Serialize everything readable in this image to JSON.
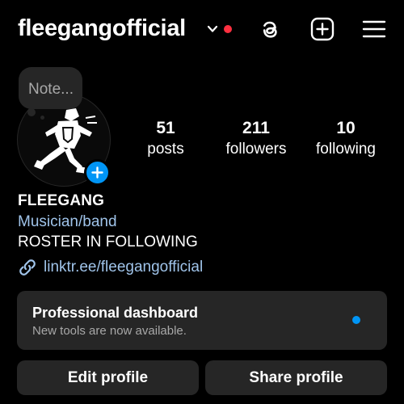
{
  "header": {
    "username": "fleegangofficial",
    "notification_dot_color": "#ff3040",
    "icons": [
      "chevron-down-icon",
      "threads-icon",
      "create-post-icon",
      "hamburger-menu-icon"
    ]
  },
  "note": {
    "placeholder": "Note..."
  },
  "profile": {
    "avatar_icon": "running-figure-logo",
    "stats": {
      "posts": {
        "count": "51",
        "label": "posts"
      },
      "followers": {
        "count": "211",
        "label": "followers"
      },
      "following": {
        "count": "10",
        "label": "following"
      }
    },
    "display_name": "FLEEGANG",
    "category": "Musician/band",
    "bio": "ROSTER IN FOLLOWING",
    "link": "linktr.ee/fleegangofficial"
  },
  "dashboard": {
    "title": "Professional dashboard",
    "subtitle": "New tools are now available.",
    "dot_color": "#0095f6"
  },
  "actions": {
    "edit_label": "Edit profile",
    "share_label": "Share profile"
  },
  "colors": {
    "background": "#000000",
    "card": "#262626",
    "link": "#a0c4ea",
    "accent": "#0095f6"
  }
}
